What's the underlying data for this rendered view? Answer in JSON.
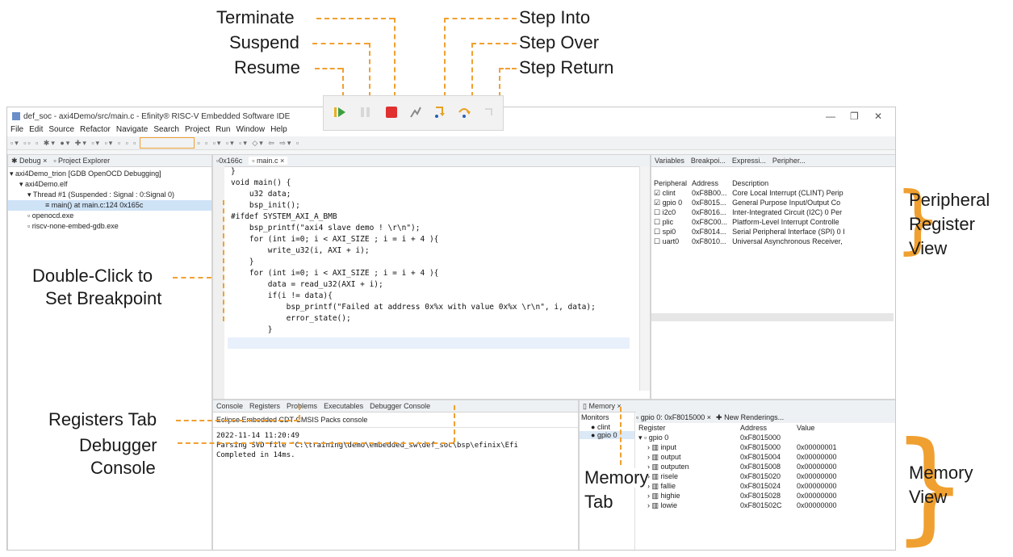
{
  "callouts": {
    "terminate": "Terminate",
    "suspend": "Suspend",
    "resume": "Resume",
    "step_into": "Step Into",
    "step_over": "Step Over",
    "step_return": "Step Return",
    "double_click_1": "Double-Click to",
    "double_click_2": "Set Breakpoint",
    "registers_tab": "Registers Tab",
    "debugger_console_1": "Debugger",
    "debugger_console_2": "Console",
    "memory_tab_1": "Memory",
    "memory_tab_2": "Tab",
    "peripheral_1": "Peripheral",
    "peripheral_2": "Register",
    "peripheral_3": "View",
    "memory_view_1": "Memory",
    "memory_view_2": "View"
  },
  "window": {
    "title": "def_soc - axi4Demo/src/main.c - Efinity® RISC-V Embedded Software IDE",
    "menu": [
      "File",
      "Edit",
      "Source",
      "Refactor",
      "Navigate",
      "Search",
      "Project",
      "Run",
      "Window",
      "Help"
    ]
  },
  "debug_panel": {
    "tab_debug": "Debug",
    "tab_project": "Project Explorer",
    "tree": [
      "axi4Demo_trion [GDB OpenOCD Debugging]",
      "axi4Demo.elf",
      "Thread #1 (Suspended : Signal : 0:Signal 0)",
      "main() at main.c:124 0x165c",
      "openocd.exe",
      "riscv-none-embed-gdb.exe"
    ]
  },
  "editor": {
    "tab1": "0x166c",
    "tab2": "main.c",
    "lines": [
      "}",
      "",
      "",
      "void main() {",
      "    u32 data;",
      "    bsp_init();",
      "",
      "#ifdef SYSTEM_AXI_A_BMB",
      "",
      "    bsp_printf(\"axi4 slave demo ! \\r\\n\");",
      "",
      "    for (int i=0; i < AXI_SIZE ; i = i + 4 ){",
      "        write_u32(i, AXI + i);",
      "    }",
      "",
      "",
      "    for (int i=0; i < AXI_SIZE ; i = i + 4 ){",
      "        data = read_u32(AXI + i);",
      "        if(i != data){",
      "            bsp_printf(\"Failed at address 0x%x with value 0x%x \\r\\n\", i, data);",
      "            error_state();",
      "        }"
    ]
  },
  "right_panel": {
    "tabs": [
      "Variables",
      "Breakpoi...",
      "Expressi...",
      "Peripher..."
    ],
    "headers": [
      "Peripheral",
      "Address",
      "Description"
    ],
    "rows": [
      {
        "name": "clint",
        "checked": true,
        "address": "0xF8B00...",
        "desc": "Core Local Interrupt (CLINT) Perip"
      },
      {
        "name": "gpio 0",
        "checked": true,
        "address": "0xF8015...",
        "desc": "General Purpose Input/Output Co"
      },
      {
        "name": "i2c0",
        "checked": false,
        "address": "0xF8016...",
        "desc": "Inter-Integrated Circuit (I2C) 0 Per"
      },
      {
        "name": "plic",
        "checked": false,
        "address": "0xF8C00...",
        "desc": "Platform-Level Interrupt Controlle"
      },
      {
        "name": "spi0",
        "checked": false,
        "address": "0xF8014...",
        "desc": "Serial Peripheral Interface (SPI) 0 I"
      },
      {
        "name": "uart0",
        "checked": false,
        "address": "0xF8010...",
        "desc": "Universal Asynchronous Receiver,"
      }
    ]
  },
  "console": {
    "tabs": [
      "Console",
      "Registers",
      "Problems",
      "Executables",
      "Debugger Console"
    ],
    "subtitle": "Eclipse Embedded CDT CMSIS Packs console",
    "lines": [
      "2022-11-14 11:20:49",
      "Parsing SVD file \"C:\\training\\demo\\embedded_sw\\def_soc\\bsp\\efinix\\Efi",
      "Completed in 14ms."
    ]
  },
  "memory": {
    "tab": "Memory",
    "monitors_label": "Monitors",
    "monitors": [
      "clint",
      "gpio 0"
    ],
    "rendering_tab": "gpio 0: 0xF8015000",
    "new_renderings": "New Renderings...",
    "headers": [
      "Register",
      "Address",
      "Value"
    ],
    "group": {
      "name": "gpio 0",
      "address": "0xF8015000"
    },
    "rows": [
      {
        "name": "input",
        "address": "0xF8015000",
        "value": "0x00000001"
      },
      {
        "name": "output",
        "address": "0xF8015004",
        "value": "0x00000000"
      },
      {
        "name": "outputen",
        "address": "0xF8015008",
        "value": "0x00000000"
      },
      {
        "name": "risele",
        "address": "0xF8015020",
        "value": "0x00000000"
      },
      {
        "name": "fallie",
        "address": "0xF8015024",
        "value": "0x00000000"
      },
      {
        "name": "highie",
        "address": "0xF8015028",
        "value": "0x00000000"
      },
      {
        "name": "lowie",
        "address": "0xF801502C",
        "value": "0x00000000"
      }
    ]
  }
}
